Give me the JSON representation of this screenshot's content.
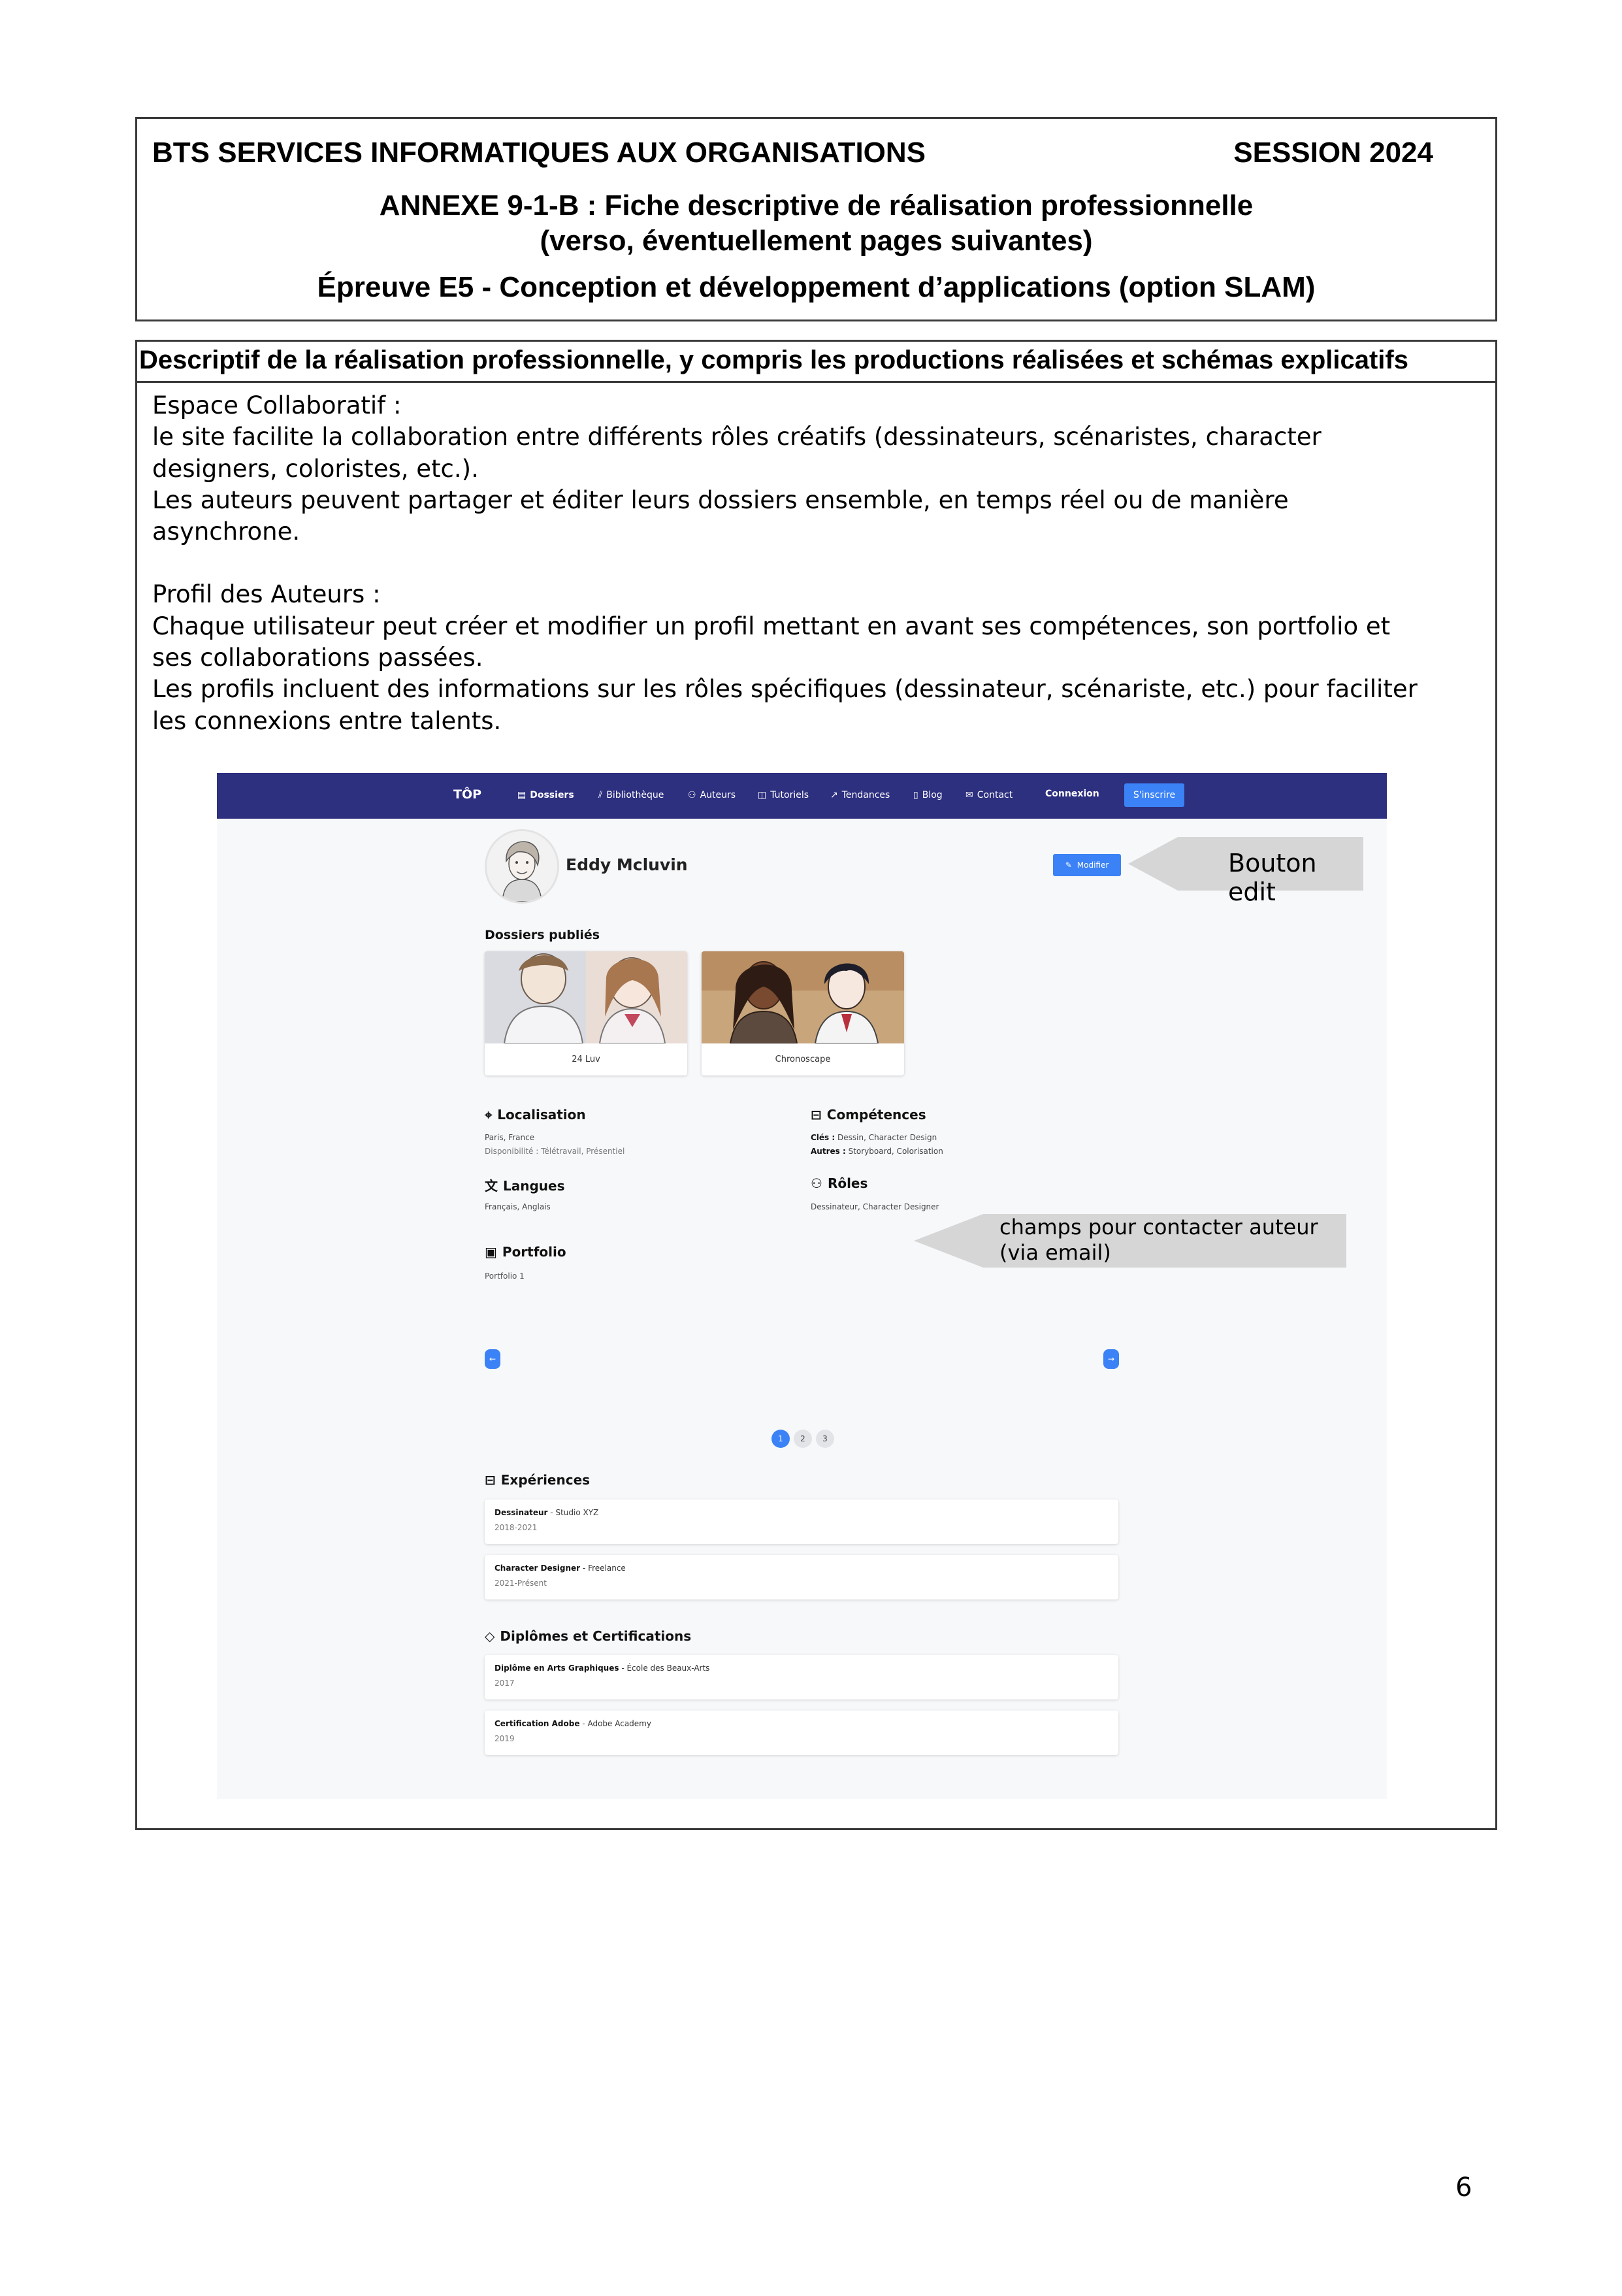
{
  "header": {
    "program": "BTS SERVICES INFORMATIQUES AUX ORGANISATIONS",
    "session": "SESSION 2024",
    "annexe_line1": "ANNEXE 9-1-B : Fiche descriptive de réalisation professionnelle",
    "annexe_line2": "(verso, éventuellement pages suivantes)",
    "epreuve": "Épreuve E5 - Conception et développement d’applications (option SLAM)"
  },
  "section_title": "Descriptif de la réalisation professionnelle, y compris les productions réalisées et schémas explicatifs",
  "description": {
    "espace_title": "Espace Collaboratif :",
    "espace_line1": "le site facilite la collaboration entre différents rôles créatifs (dessinateurs, scénaristes, character",
    "espace_line2": "designers, coloristes, etc.).",
    "espace_line3": "Les auteurs peuvent partager et éditer leurs dossiers ensemble, en temps réel ou de manière",
    "espace_line4": "asynchrone.",
    "profil_title": "Profil des Auteurs :",
    "profil_line1": "Chaque utilisateur peut créer et modifier un profil mettant en avant ses compétences, son portfolio et",
    "profil_line2": "ses collaborations passées.",
    "profil_line3": "Les profils incluent des informations sur les rôles spécifiques (dessinateur, scénariste, etc.) pour faciliter",
    "profil_line4": "les connexions entre talents."
  },
  "screenshot": {
    "nav": {
      "logo": "TÔP",
      "items": [
        {
          "label": "Dossiers",
          "icon": "file-icon"
        },
        {
          "label": "Bibliothèque",
          "icon": "library-icon"
        },
        {
          "label": "Auteurs",
          "icon": "users-icon"
        },
        {
          "label": "Tutoriels",
          "icon": "book-icon"
        },
        {
          "label": "Tendances",
          "icon": "trending-icon"
        },
        {
          "label": "Blog",
          "icon": "blog-icon"
        },
        {
          "label": "Contact",
          "icon": "mail-icon"
        }
      ],
      "login": "Connexion",
      "signup": "S'inscrire"
    },
    "profile": {
      "name": "Eddy Mcluvin",
      "edit_label": "Modifier"
    },
    "dossiers": {
      "title": "Dossiers publiés",
      "items": [
        "24 Luv",
        "Chronoscape"
      ]
    },
    "localisation": {
      "title": "Localisation",
      "city": "Paris, France",
      "availability": "Disponibilité : Télétravail, Présentiel"
    },
    "competences": {
      "title": "Compétences",
      "key_label": "Clés :",
      "key_value": "Dessin, Character Design",
      "other_label": "Autres :",
      "other_value": "Storyboard, Colorisation"
    },
    "langues": {
      "title": "Langues",
      "value": "Français, Anglais"
    },
    "roles": {
      "title": "Rôles",
      "value": "Dessinateur, Character Designer"
    },
    "portfolio": {
      "title": "Portfolio",
      "image_alt": "Portfolio 1",
      "prev": "←",
      "next": "→",
      "pages": [
        "1",
        "2",
        "3"
      ]
    },
    "experiences": {
      "title": "Expériences",
      "items": [
        {
          "role": "Dessinateur",
          "org": "Studio XYZ",
          "dates": "2018-2021"
        },
        {
          "role": "Character Designer",
          "org": "Freelance",
          "dates": "2021-Présent"
        }
      ]
    },
    "diplomes": {
      "title": "Diplômes et Certifications",
      "items": [
        {
          "name": "Diplôme en Arts Graphiques",
          "org": "École des Beaux-Arts",
          "year": "2017"
        },
        {
          "name": "Certification Adobe",
          "org": "Adobe Academy",
          "year": "2019"
        }
      ]
    },
    "separator": " - ",
    "callouts": {
      "edit": "Bouton edit",
      "contact_line1": "champs pour contacter auteur",
      "contact_line2": "(via email)"
    },
    "colors": {
      "nav_bg": "#2d2f7f",
      "accent": "#3b82f6",
      "page_bg": "#f7f8fa"
    }
  },
  "page_number": "6"
}
